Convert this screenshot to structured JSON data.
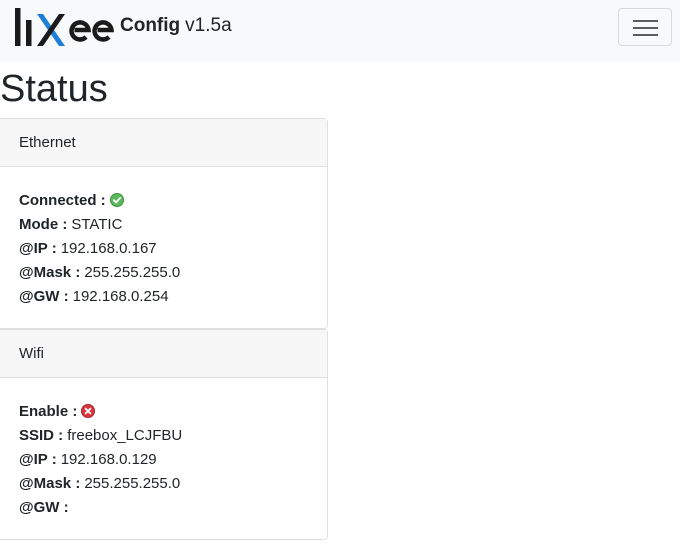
{
  "navbar": {
    "logo_text": "lixee",
    "brand_bold": "Config",
    "brand_version": "v1.5a",
    "menu_icon": "hamburger-icon"
  },
  "page": {
    "title": "Status"
  },
  "ethernet": {
    "header": "Ethernet",
    "connected_label": "Connected :",
    "connected_state": "ok",
    "connected_icon": "check-circle-icon",
    "mode_label": "Mode :",
    "mode_value": "STATIC",
    "ip_label": "@IP :",
    "ip_value": "192.168.0.167",
    "mask_label": "@Mask :",
    "mask_value": "255.255.255.0",
    "gw_label": "@GW :",
    "gw_value": "192.168.0.254"
  },
  "wifi": {
    "header": "Wifi",
    "enable_label": "Enable :",
    "enable_state": "disabled",
    "enable_icon": "x-circle-icon",
    "ssid_label": "SSID :",
    "ssid_value": "freebox_LCJFBU",
    "ip_label": "@IP :",
    "ip_value": "192.168.0.129",
    "mask_label": "@Mask :",
    "mask_value": "255.255.255.0",
    "gw_label": "@GW :",
    "gw_value": ""
  },
  "colors": {
    "navbar_bg": "#f8f9fa",
    "status_ok": "#5cb85c",
    "status_error": "#d9363e",
    "logo_dark": "#1a1a1a",
    "logo_accent": "#1e7fd6"
  }
}
